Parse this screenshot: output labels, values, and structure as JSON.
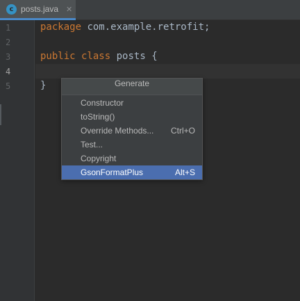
{
  "tabs": [
    {
      "icon": "java-class-icon",
      "icon_glyph": "c",
      "label": "posts.java",
      "close_glyph": "✕"
    }
  ],
  "editor": {
    "line_numbers": [
      "1",
      "2",
      "3",
      "4",
      "5"
    ],
    "lines": {
      "l1_keyword": "package",
      "l1_rest": " com.example.retrofit;",
      "l3_kw1": "public",
      "l3_kw2": "class",
      "l3_name": "posts",
      "l3_brace": "{",
      "l5_brace": "}"
    }
  },
  "generate_popup": {
    "title": "Generate",
    "items": [
      {
        "label": "Constructor",
        "shortcut": ""
      },
      {
        "label": "toString()",
        "shortcut": ""
      },
      {
        "label": "Override Methods...",
        "shortcut": "Ctrl+O"
      },
      {
        "label": "Test...",
        "shortcut": ""
      },
      {
        "label": "Copyright",
        "shortcut": ""
      },
      {
        "label": "GsonFormatPlus",
        "shortcut": "Alt+S",
        "selected": true
      }
    ]
  },
  "colors": {
    "background": "#2b2b2b",
    "keyword": "#cc7832",
    "text": "#a9b7c6",
    "selection": "#4b6eaf",
    "tab_underline": "#4a88c7"
  }
}
